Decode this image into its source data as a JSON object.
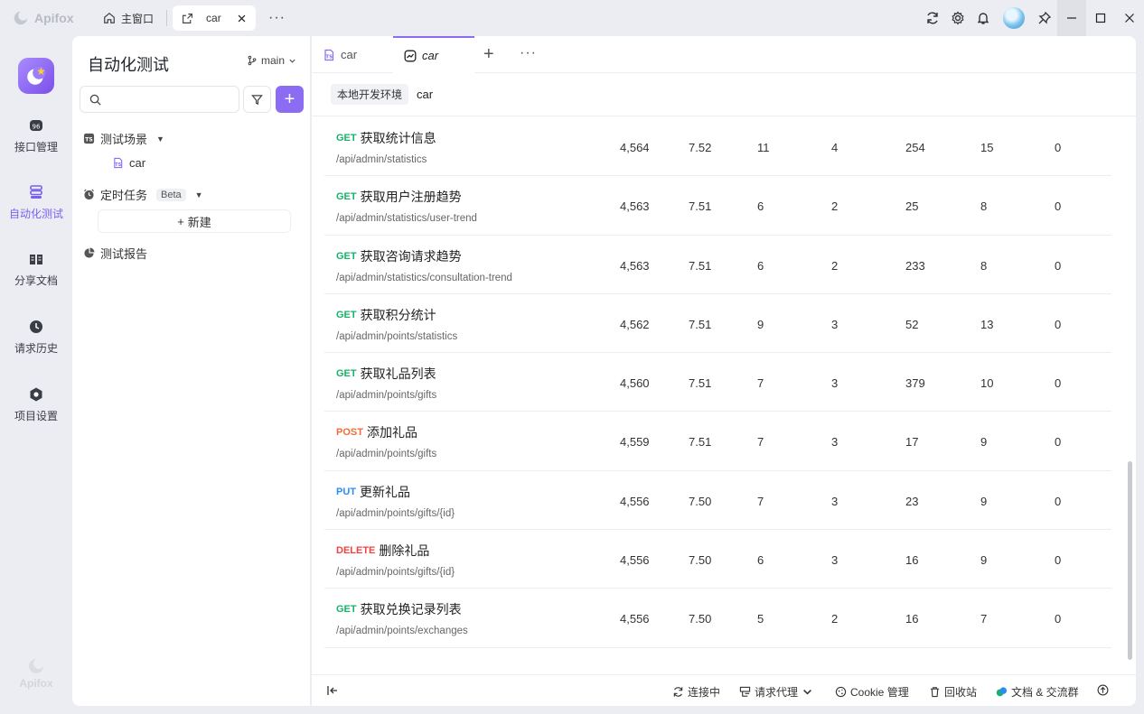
{
  "titlebar": {
    "app_name": "Apifox",
    "main_window_label": "主窗口",
    "active_tab_label": "car"
  },
  "rail": {
    "items": [
      {
        "label": "接口管理"
      },
      {
        "label": "自动化测试"
      },
      {
        "label": "分享文档"
      },
      {
        "label": "请求历史"
      },
      {
        "label": "项目设置"
      }
    ],
    "bottom_label": "Apifox"
  },
  "left_panel": {
    "title": "自动化测试",
    "branch": "main",
    "search_placeholder": "",
    "tree": {
      "scenes_label": "测试场景",
      "scene_item": "car",
      "scheduled_label": "定时任务",
      "beta_badge": "Beta",
      "new_label": "新建",
      "reports_label": "测试报告"
    }
  },
  "main": {
    "tabs": [
      {
        "label": "car"
      },
      {
        "label": "car"
      }
    ],
    "env_tag": "本地开发环境",
    "env_name": "car",
    "rows": [
      {
        "method": "GET",
        "name": "获取统计信息",
        "path": "/api/admin/statistics",
        "v1": "4,564",
        "v2": "7.52",
        "v3": "11",
        "v4": "4",
        "v5": "254",
        "v6": "15",
        "v7": "0"
      },
      {
        "method": "GET",
        "name": "获取用户注册趋势",
        "path": "/api/admin/statistics/user-trend",
        "v1": "4,563",
        "v2": "7.51",
        "v3": "6",
        "v4": "2",
        "v5": "25",
        "v6": "8",
        "v7": "0"
      },
      {
        "method": "GET",
        "name": "获取咨询请求趋势",
        "path": "/api/admin/statistics/consultation-trend",
        "v1": "4,563",
        "v2": "7.51",
        "v3": "6",
        "v4": "2",
        "v5": "233",
        "v6": "8",
        "v7": "0"
      },
      {
        "method": "GET",
        "name": "获取积分统计",
        "path": "/api/admin/points/statistics",
        "v1": "4,562",
        "v2": "7.51",
        "v3": "9",
        "v4": "3",
        "v5": "52",
        "v6": "13",
        "v7": "0"
      },
      {
        "method": "GET",
        "name": "获取礼品列表",
        "path": "/api/admin/points/gifts",
        "v1": "4,560",
        "v2": "7.51",
        "v3": "7",
        "v4": "3",
        "v5": "379",
        "v6": "10",
        "v7": "0"
      },
      {
        "method": "POST",
        "name": "添加礼品",
        "path": "/api/admin/points/gifts",
        "v1": "4,559",
        "v2": "7.51",
        "v3": "7",
        "v4": "3",
        "v5": "17",
        "v6": "9",
        "v7": "0"
      },
      {
        "method": "PUT",
        "name": "更新礼品",
        "path": "/api/admin/points/gifts/{id}",
        "v1": "4,556",
        "v2": "7.50",
        "v3": "7",
        "v4": "3",
        "v5": "23",
        "v6": "9",
        "v7": "0"
      },
      {
        "method": "DELETE",
        "name": "删除礼品",
        "path": "/api/admin/points/gifts/{id}",
        "v1": "4,556",
        "v2": "7.50",
        "v3": "6",
        "v4": "3",
        "v5": "16",
        "v6": "9",
        "v7": "0"
      },
      {
        "method": "GET",
        "name": "获取兑换记录列表",
        "path": "/api/admin/points/exchanges",
        "v1": "4,556",
        "v2": "7.50",
        "v3": "5",
        "v4": "2",
        "v5": "16",
        "v6": "7",
        "v7": "0"
      }
    ],
    "method_colors": {
      "GET": "#17b26a",
      "POST": "#f26b3a",
      "PUT": "#2a8ef0",
      "DELETE": "#ef4444"
    }
  },
  "statusbar": {
    "connecting": "连接中",
    "proxy": "请求代理",
    "cookie": "Cookie 管理",
    "recycle": "回收站",
    "docs": "文档 & 交流群"
  }
}
